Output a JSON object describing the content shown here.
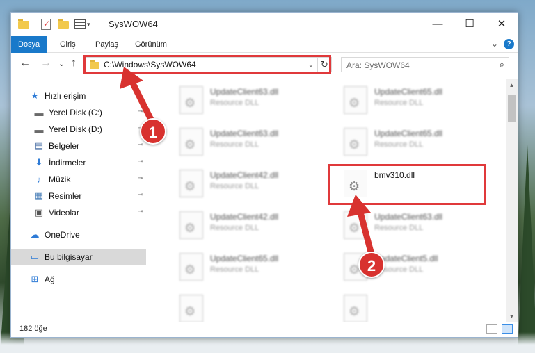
{
  "window": {
    "title": "SysWOW64",
    "minimize": "—",
    "maximize": "☐",
    "close": "✕"
  },
  "ribbon": {
    "tabs": [
      {
        "label": "Dosya",
        "active": true
      },
      {
        "label": "Giriş",
        "active": false
      },
      {
        "label": "Paylaş",
        "active": false
      },
      {
        "label": "Görünüm",
        "active": false
      }
    ],
    "expand": "⌄",
    "help": "?"
  },
  "nav": {
    "back": "←",
    "forward": "→",
    "recent": "⌄",
    "up": "↑",
    "address": "C:\\Windows\\SysWOW64",
    "address_dropdown": "⌄",
    "refresh": "↻",
    "search_placeholder": "Ara: SysWOW64",
    "search_icon": "⌕"
  },
  "sidebar": {
    "items": [
      {
        "label": "Hızlı erişim",
        "icon": "star-icon",
        "glyph": "★",
        "color": "#2e7bd6",
        "pinned": false,
        "selected": false,
        "indent": false
      },
      {
        "label": "Yerel Disk (C:)",
        "icon": "drive-icon",
        "glyph": "▬",
        "color": "#6a6a6a",
        "pinned": true,
        "selected": false,
        "indent": true
      },
      {
        "label": "Yerel Disk (D:)",
        "icon": "drive-icon",
        "glyph": "▬",
        "color": "#6a6a6a",
        "pinned": true,
        "selected": false,
        "indent": true
      },
      {
        "label": "Belgeler",
        "icon": "documents-icon",
        "glyph": "▤",
        "color": "#4a6fa5",
        "pinned": true,
        "selected": false,
        "indent": true
      },
      {
        "label": "İndirmeler",
        "icon": "download-icon",
        "glyph": "⬇",
        "color": "#2e7bd6",
        "pinned": true,
        "selected": false,
        "indent": true
      },
      {
        "label": "Müzik",
        "icon": "music-icon",
        "glyph": "♪",
        "color": "#2e7bd6",
        "pinned": true,
        "selected": false,
        "indent": true
      },
      {
        "label": "Resimler",
        "icon": "pictures-icon",
        "glyph": "▦",
        "color": "#4a7fb8",
        "pinned": true,
        "selected": false,
        "indent": true
      },
      {
        "label": "Videolar",
        "icon": "videos-icon",
        "glyph": "▣",
        "color": "#555555",
        "pinned": true,
        "selected": false,
        "indent": true
      },
      {
        "label": "OneDrive",
        "icon": "cloud-icon",
        "glyph": "☁",
        "color": "#2e7bd6",
        "pinned": false,
        "selected": false,
        "indent": false
      },
      {
        "label": "Bu bilgisayar",
        "icon": "computer-icon",
        "glyph": "▭",
        "color": "#2e7bd6",
        "pinned": false,
        "selected": true,
        "indent": false
      },
      {
        "label": "Ağ",
        "icon": "network-icon",
        "glyph": "⊞",
        "color": "#2e7bd6",
        "pinned": false,
        "selected": false,
        "indent": false
      }
    ],
    "pin_glyph": "📌"
  },
  "files": [
    {
      "name": "UpdateClient63.dll",
      "type": "Resource DLL",
      "blurred": true
    },
    {
      "name": "UpdateClient65.dll",
      "type": "Resource DLL",
      "blurred": true
    },
    {
      "name": "UpdateClient63.dll",
      "type": "Resource DLL",
      "blurred": true
    },
    {
      "name": "UpdateClient65.dll",
      "type": "Resource DLL",
      "blurred": true
    },
    {
      "name": "UpdateClient42.dll",
      "type": "Resource DLL",
      "blurred": true
    },
    {
      "name": "bmv310.dll",
      "type": "",
      "blurred": false
    },
    {
      "name": "UpdateClient42.dll",
      "type": "Resource DLL",
      "blurred": true
    },
    {
      "name": "UpdateClient63.dll",
      "type": "Resource DLL",
      "blurred": true
    },
    {
      "name": "UpdateClient65.dll",
      "type": "Resource DLL",
      "blurred": true
    },
    {
      "name": "UpdateClient5.dll",
      "type": "Resource DLL",
      "blurred": true
    },
    {
      "name": "",
      "type": "",
      "blurred": true
    },
    {
      "name": "",
      "type": "",
      "blurred": true
    }
  ],
  "status": {
    "count": "182 öğe"
  },
  "annotations": {
    "step1": "1",
    "step2": "2",
    "color": "#d8322f"
  }
}
